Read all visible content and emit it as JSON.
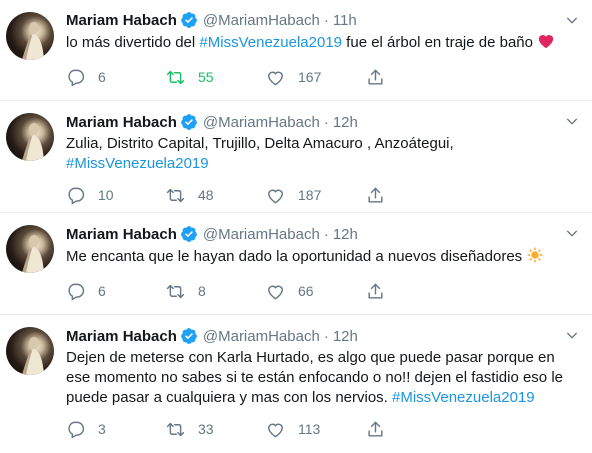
{
  "tweets": [
    {
      "name": "Mariam Habach",
      "handle": "@MariamHabach",
      "time": "11h",
      "text": "lo más  divertido del ",
      "hashtag": "#MissVenezuela2019",
      "text_after": " fue el árbol en traje de baño ",
      "emoji": "red-heart",
      "replies": "6",
      "retweets": "55",
      "likes": "167",
      "retweeted": true
    },
    {
      "name": "Mariam Habach",
      "handle": "@MariamHabach",
      "time": "12h",
      "text": "Zulia, Distrito Capital, Trujillo, Delta Amacuro , Anzoátegui,",
      "hashtag": "#MissVenezuela2019",
      "replies": "10",
      "retweets": "48",
      "likes": "187",
      "retweeted": false
    },
    {
      "name": "Mariam Habach",
      "handle": "@MariamHabach",
      "time": "12h",
      "text": "Me encanta que le hayan dado la oportunidad a nuevos diseñadores ",
      "emoji": "sun",
      "replies": "6",
      "retweets": "8",
      "likes": "66",
      "retweeted": false
    },
    {
      "name": "Mariam Habach",
      "handle": "@MariamHabach",
      "time": "12h",
      "text": "Dejen de meterse con Karla Hurtado, es algo que puede pasar porque en ese momento no sabes si te están enfocando o no!! dejen el fastidio eso le puede pasar a cualquiera y mas con los nervios. ",
      "hashtag": "#MissVenezuela2019",
      "replies": "3",
      "retweets": "33",
      "likes": "113",
      "retweeted": false
    }
  ],
  "colors": {
    "accent": "#1da1f2",
    "hashtag": "#1b95e0",
    "retweet": "#17bf63",
    "heart": "#e0245e",
    "muted": "#657786"
  },
  "icons": [
    "verified-badge-icon",
    "chevron-down-icon",
    "reply-icon",
    "retweet-icon",
    "like-icon",
    "share-icon",
    "heart-emoji-icon",
    "sun-emoji-icon"
  ]
}
